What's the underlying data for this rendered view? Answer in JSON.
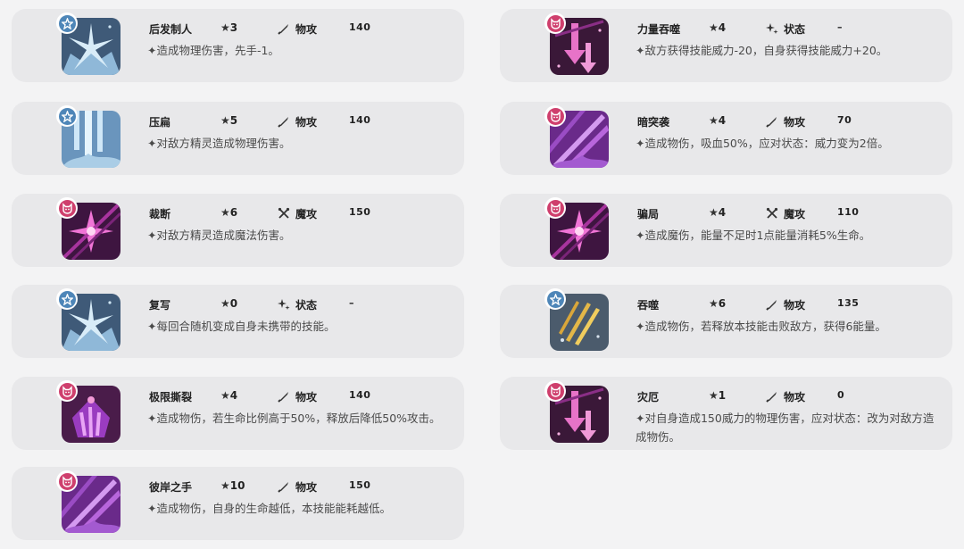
{
  "skills": [
    {
      "name": "后发制人",
      "stars": "3",
      "category": "物攻",
      "power": "140",
      "desc": "✦造成物理伤害，先手-1。",
      "badge": "blue",
      "art": "blue-burst"
    },
    {
      "name": "力量吞噬",
      "stars": "4",
      "category": "状态",
      "power": "–",
      "desc": "✦敌方获得技能威力-20，自身获得技能威力+20。",
      "badge": "pink",
      "art": "purple-arrows"
    },
    {
      "name": "压扁",
      "stars": "5",
      "category": "物攻",
      "power": "140",
      "desc": "✦对敌方精灵造成物理伤害。",
      "badge": "blue",
      "art": "blue-crush"
    },
    {
      "name": "暗突袭",
      "stars": "4",
      "category": "物攻",
      "power": "70",
      "desc": "✦造成物伤，吸血50%，应对状态：威力变为2倍。",
      "badge": "pink",
      "art": "purple-slash"
    },
    {
      "name": "裁断",
      "stars": "6",
      "category": "魔攻",
      "power": "150",
      "desc": "✦对敌方精灵造成魔法伤害。",
      "badge": "pink",
      "art": "purple-star"
    },
    {
      "name": "骗局",
      "stars": "4",
      "category": "魔攻",
      "power": "110",
      "desc": "✦造成魔伤，能量不足时1点能量消耗5%生命。",
      "badge": "pink",
      "art": "purple-star"
    },
    {
      "name": "复写",
      "stars": "0",
      "category": "状态",
      "power": "–",
      "desc": "✦每回合随机变成自身未携带的技能。",
      "badge": "blue",
      "art": "blue-burst"
    },
    {
      "name": "吞噬",
      "stars": "6",
      "category": "物攻",
      "power": "135",
      "desc": "✦造成物伤，若释放本技能击败敌方，获得6能量。",
      "badge": "blue",
      "art": "gray-claw"
    },
    {
      "name": "极限撕裂",
      "stars": "4",
      "category": "物攻",
      "power": "140",
      "desc": "✦造成物伤，若生命比例高于50%，释放后降低50%攻击。",
      "badge": "pink",
      "art": "purple-claw"
    },
    {
      "name": "灾厄",
      "stars": "1",
      "category": "物攻",
      "power": "0",
      "desc": "✦对自身造成150威力的物理伤害，应对状态：改为对敌方造成物伤。",
      "badge": "pink",
      "art": "purple-arrows"
    },
    {
      "name": "彼岸之手",
      "stars": "10",
      "category": "物攻",
      "power": "150",
      "desc": "✦造成物伤，自身的生命越低，本技能能耗越低。",
      "badge": "pink",
      "art": "purple-slash"
    }
  ],
  "icons": {
    "star": "★",
    "physical": "sword-icon",
    "magic": "crossed-wands-icon",
    "status": "sparkle-icon"
  },
  "colors": {
    "card": "#e8e8ea",
    "badge_blue": "#4e86b8",
    "badge_pink": "#cf3f6d"
  }
}
